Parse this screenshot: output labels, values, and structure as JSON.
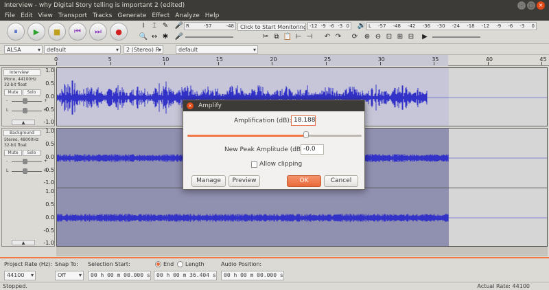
{
  "window": {
    "title": "Interview - why Digital Story telling is important 2 (edited)"
  },
  "menu": [
    "File",
    "Edit",
    "View",
    "Transport",
    "Tracks",
    "Generate",
    "Effect",
    "Analyze",
    "Help"
  ],
  "toolbar": {
    "pause": "⏸",
    "play": "▶",
    "stop": "■",
    "skip_start": "⏮",
    "skip_end": "⏭",
    "record": "●",
    "rec_meter_label": "R",
    "rec_meter_ticks": [
      "-57",
      "-48"
    ],
    "monitor_text": "Click to Start Monitoring",
    "monitor_ticks": [
      "-12",
      "-9",
      "-6",
      "-3",
      "0"
    ],
    "play_meter_label_l": "L",
    "play_meter_label_r": "R",
    "play_meter_ticks": [
      "-57",
      "-48",
      "-42",
      "-36",
      "-30",
      "-24",
      "-18",
      "-12",
      "-9",
      "-6",
      "-3",
      "0"
    ],
    "meter_ticks_right": [
      "-42",
      "-36",
      "-30",
      "-24",
      "-18",
      "-12",
      "-9",
      "-6",
      "-3",
      "0"
    ]
  },
  "devices": {
    "host": "ALSA",
    "rec_device": "default",
    "channels": "2 (Stereo) R",
    "play_device": "default"
  },
  "ruler": {
    "ticks": [
      "0",
      "5",
      "10",
      "15",
      "20",
      "25",
      "30",
      "35",
      "40",
      "45"
    ]
  },
  "tracks": [
    {
      "name": "Interview",
      "info1": "Mono, 44100Hz",
      "info2": "32-bit float",
      "mute": "Mute",
      "solo": "Solo",
      "left": "L",
      "right": "R",
      "scale": [
        "1.0",
        "0.5",
        "0.0",
        "-0.5",
        "-1.0"
      ]
    },
    {
      "name": "Background",
      "info1": "Stereo, 48000Hz",
      "info2": "32-bit float",
      "mute": "Mute",
      "solo": "Solo",
      "left": "L",
      "right": "R",
      "scale": [
        "1.0",
        "0.5",
        "0.0",
        "-0.5",
        "-1.0"
      ],
      "scale2": [
        "1.0",
        "0.5",
        "0.0",
        "-0.5",
        "-1.0"
      ]
    }
  ],
  "dialog": {
    "title": "Amplify",
    "amplification_label": "Amplification (dB):",
    "amplification_value": "18.188",
    "slider_fraction": 0.68,
    "peak_label": "New Peak Amplitude (dB):",
    "peak_value": "-0.0",
    "allow_clipping_label": "Allow clipping",
    "allow_clipping": false,
    "manage": "Manage",
    "preview": "Preview",
    "ok": "OK",
    "cancel": "Cancel"
  },
  "selection_bar": {
    "project_rate_label": "Project Rate (Hz):",
    "project_rate": "44100",
    "snap_label": "Snap To:",
    "snap_value": "Off",
    "selection_start_label": "Selection Start:",
    "selection_start": "00 h 00 m 00.000 s",
    "end_label": "End",
    "length_label": "Length",
    "selection_end": "00 h 00 m 36.404 s",
    "audio_position_label": "Audio Position:",
    "audio_position": "00 h 00 m 00.000 s"
  },
  "status": {
    "left": "Stopped.",
    "right": "Actual Rate: 44100"
  },
  "colors": {
    "accent": "#f07746",
    "wave": "#3232c8",
    "wave_bg_selected": "#9090b0",
    "titlebar": "#3c3b37"
  }
}
